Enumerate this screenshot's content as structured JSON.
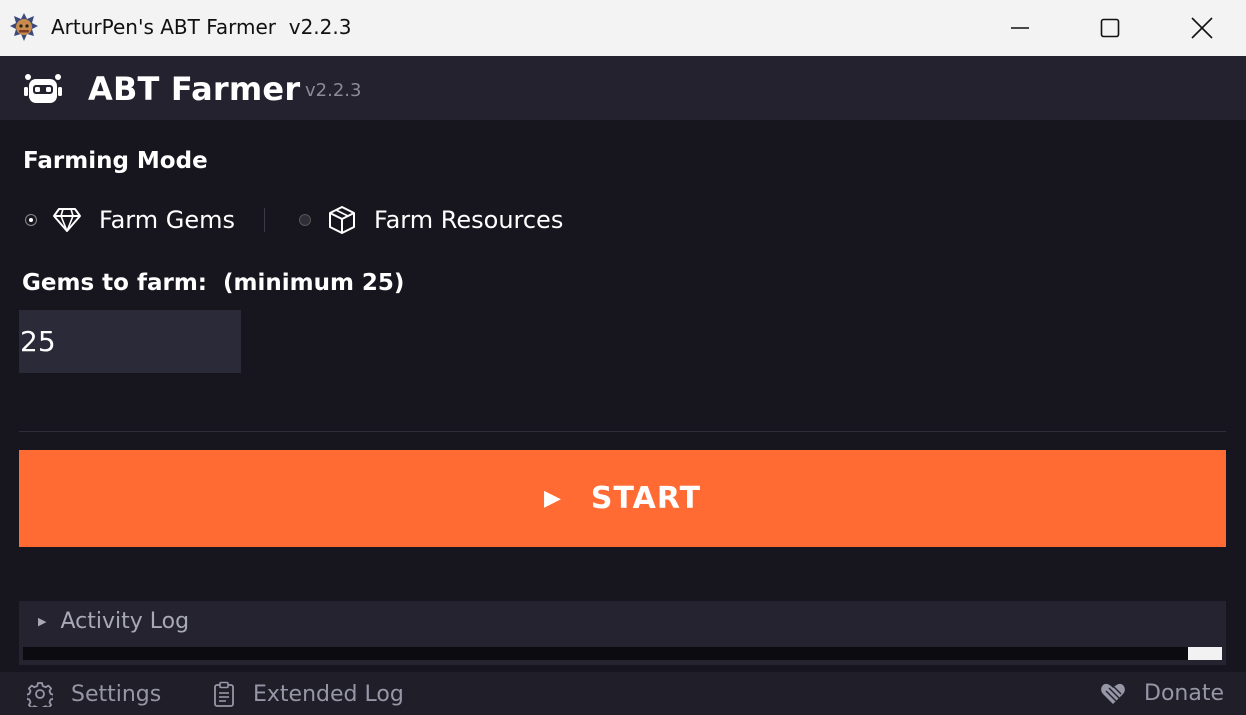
{
  "window": {
    "title": "ArturPen's ABT Farmer  v2.2.3"
  },
  "header": {
    "app_name": "ABT Farmer",
    "version": "v2.2.3"
  },
  "farming_mode": {
    "title": "Farming Mode",
    "options": [
      {
        "label": "Farm Gems",
        "icon": "gem-icon",
        "selected": true
      },
      {
        "label": "Farm Resources",
        "icon": "box-icon",
        "selected": false
      }
    ]
  },
  "gems": {
    "label": "Gems to farm:  (minimum 25)",
    "value": "25"
  },
  "start": {
    "icon": "▶",
    "label": "START"
  },
  "activity_log": {
    "label": "Activity Log",
    "scroll_position": 1.0
  },
  "footer": {
    "settings": "Settings",
    "extended_log": "Extended Log",
    "donate": "Donate"
  },
  "colors": {
    "accent": "#ff6b33",
    "background": "#17161f",
    "header": "#23222e",
    "muted_text": "#9796a6"
  }
}
